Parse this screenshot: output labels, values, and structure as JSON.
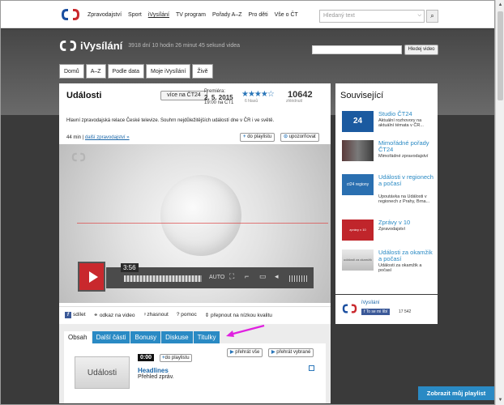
{
  "topnav": {
    "items": [
      "Zpravodajství",
      "Sport",
      "iVysílání",
      "TV program",
      "Pořady A–Z",
      "Pro děti",
      "Vše o ČT"
    ],
    "search_placeholder": "Hledaný text",
    "search_icon": "magnifier-icon"
  },
  "ivheader": {
    "brand": "iVysílání",
    "tagline": "3918 dní 10 hodin 26 minut 45 sekund videa",
    "search_button": "Hledej video"
  },
  "mainnav": [
    "Domů",
    "A–Z",
    "Podle data",
    "Moje iVysílání",
    "Živě"
  ],
  "program": {
    "title": "Události",
    "more_button": "více na ČT24",
    "premiere_label": "Premiéra:",
    "premiere_date": "2. 5. 2015",
    "premiere_time": "19:00 na ČT1",
    "stars": "★★★★☆",
    "rating_count": "6 hlasů",
    "views": "10642",
    "views_label": "zhlédnutí",
    "description": "Hlavní zpravodajská relace České televize. Souhrn nejdůležitějších událostí dne v ČR i ve světě.",
    "duration_text": "44 min |",
    "genre_link": "další zpravodajství »",
    "add_playlist": "do playlistu",
    "notify": "upozorňovat"
  },
  "player": {
    "time": "3:56",
    "quality": "AUTO",
    "progress": 0.0
  },
  "actions": [
    "sdílet",
    "odkaz na video",
    "zhasnout",
    "pomoc",
    "přepnout na nízkou kvalitu"
  ],
  "tabs": [
    "Obsah",
    "Další části",
    "Bonusy",
    "Diskuse",
    "Titulky"
  ],
  "panel": {
    "play_all": "přehrát vše",
    "play_selected": "přehrát vybrané",
    "item_duration": "0:00",
    "item_add": "do playlistu",
    "thumb_label": "Události",
    "item_title": "Headlines",
    "item_desc": "Přehled zpráv."
  },
  "sidebar": {
    "title": "Související",
    "items": [
      {
        "title": "Studio ČT24",
        "desc": "Aktuální rozhovory na aktuální témata v ČR...",
        "thumb": "24"
      },
      {
        "title": "Mimořádné pořady ČT24",
        "desc": "Mimořádné zpravodajství",
        "thumb": ""
      },
      {
        "title": "Události v regionech a počasí",
        "desc": "Upoutávka na Události v regionech z Prahy, Brna...",
        "thumb": "ct24 regiony"
      },
      {
        "title": "Zprávy v 10",
        "desc": "Zpravodajství",
        "thumb": "zprávy v 10"
      },
      {
        "title": "Události za okamžik a počasí",
        "desc": "Události za okamžik a počasí",
        "thumb": "události za okamžik"
      }
    ],
    "fb_brand": "iVysílání",
    "fb_like": "To se mi líbí",
    "fb_count": "17 542"
  },
  "my_playlist": "Zobrazit můj playlist",
  "colors": {
    "accent": "#2a8ac4",
    "brand_red": "#c9282d",
    "arrow": "#e020e0"
  }
}
